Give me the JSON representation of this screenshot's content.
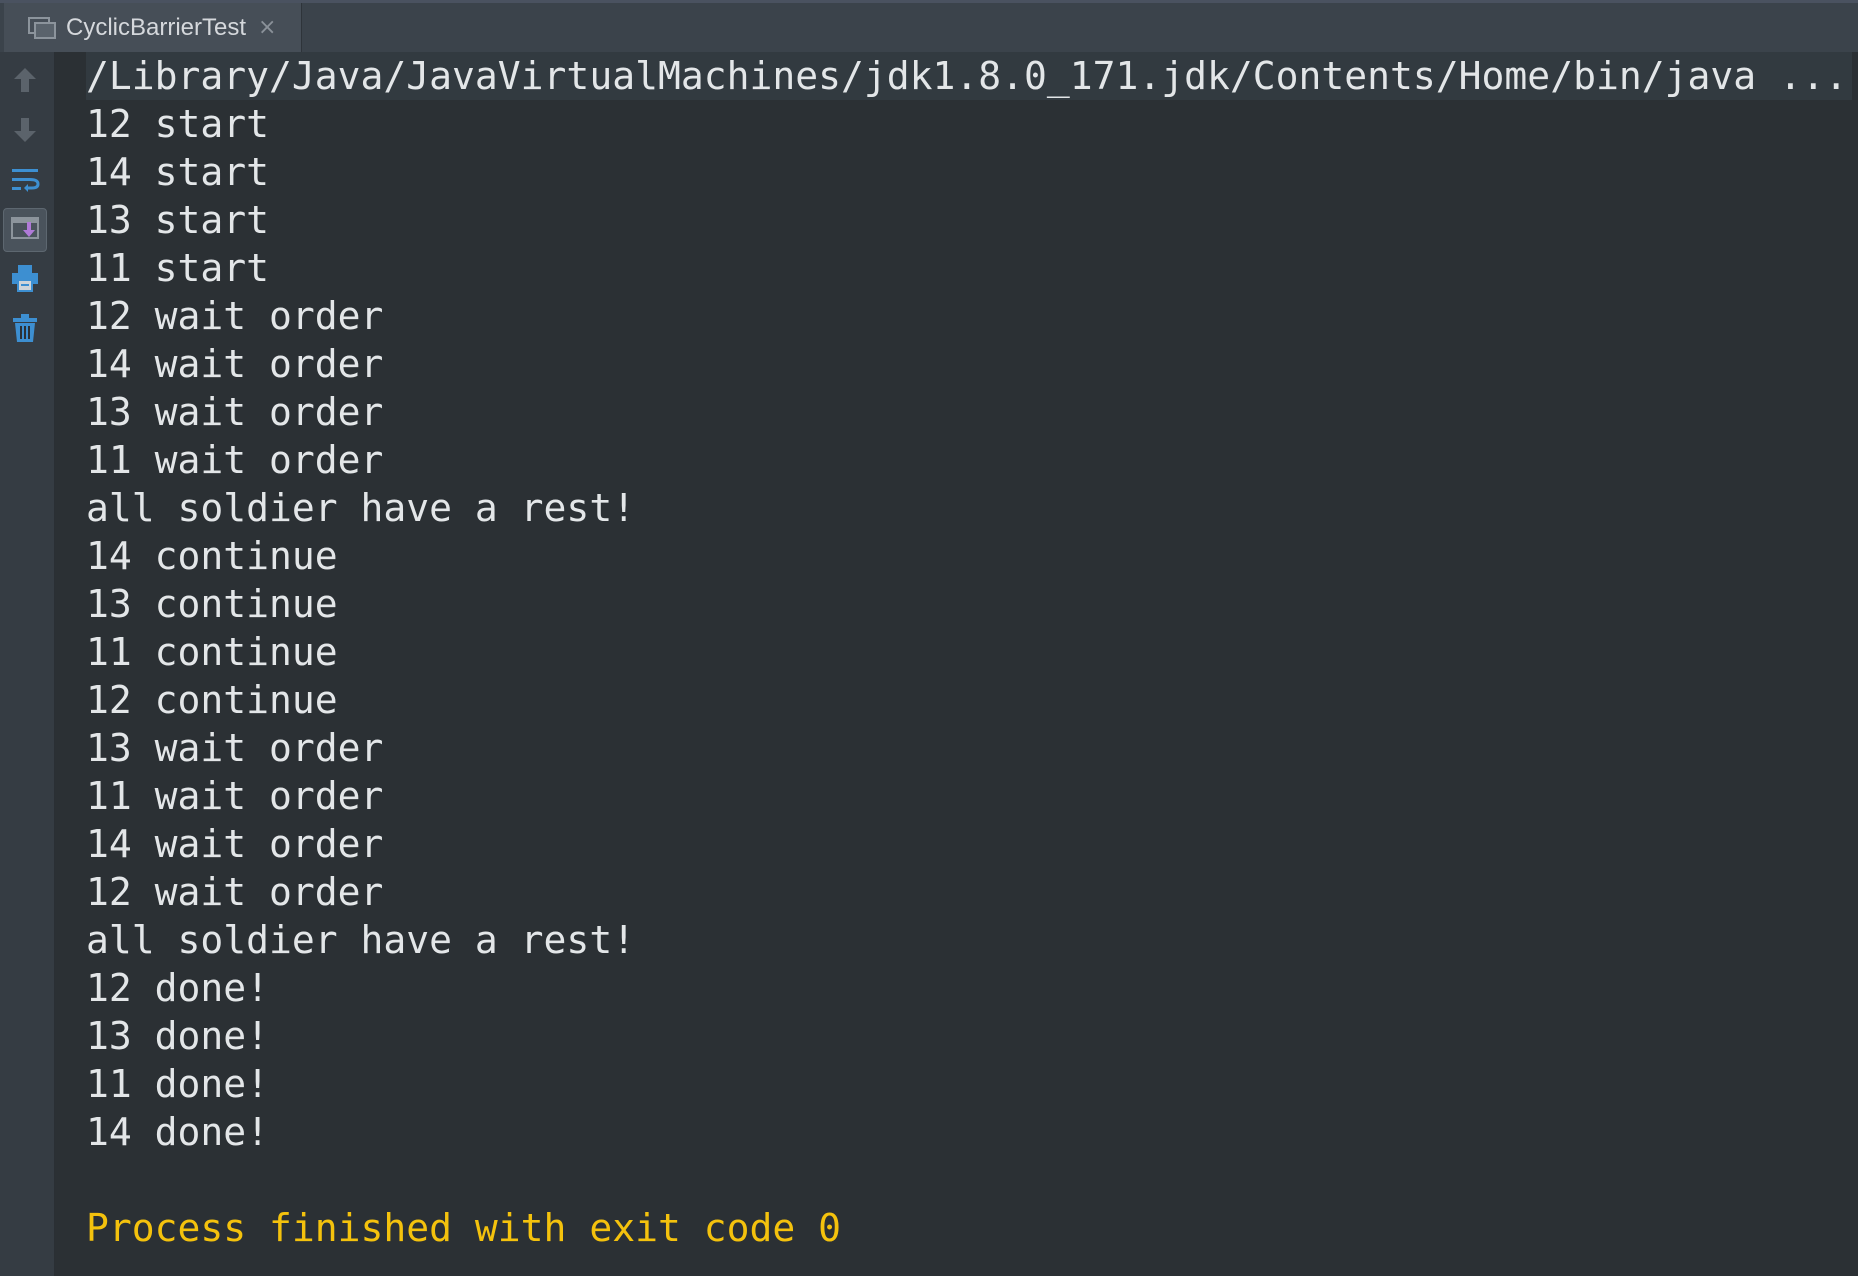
{
  "tab": {
    "title": "CyclicBarrierTest",
    "close_glyph": "×",
    "icon": "console-window-icon"
  },
  "toolbar": {
    "tools": [
      {
        "name": "scroll-up-icon",
        "label": "Up to previous"
      },
      {
        "name": "scroll-down-icon",
        "label": "Down to next"
      },
      {
        "name": "soft-wrap-icon",
        "label": "Soft-wrap"
      },
      {
        "name": "scroll-to-end-icon",
        "label": "Scroll to end",
        "active": true
      },
      {
        "name": "print-icon",
        "label": "Print"
      },
      {
        "name": "clear-all-icon",
        "label": "Clear all"
      }
    ]
  },
  "console": {
    "command": "/Library/Java/JavaVirtualMachines/jdk1.8.0_171.jdk/Contents/Home/bin/java ...",
    "lines": [
      "12 start",
      "14 start",
      "13 start",
      "11 start",
      "12 wait order",
      "14 wait order",
      "13 wait order",
      "11 wait order",
      "all soldier have a rest!",
      "14 continue",
      "13 continue",
      "11 continue",
      "12 continue",
      "13 wait order",
      "11 wait order",
      "14 wait order",
      "12 wait order",
      "all soldier have a rest!",
      "12 done!",
      "13 done!",
      "11 done!",
      "14 done!"
    ],
    "exit_message": "Process finished with exit code 0"
  },
  "colors": {
    "background": "#2b3034",
    "text": "#e3e6e8",
    "exit_text": "#f4c20d",
    "accent_blue": "#3d8fd1",
    "accent_purple": "#b07ad8"
  }
}
